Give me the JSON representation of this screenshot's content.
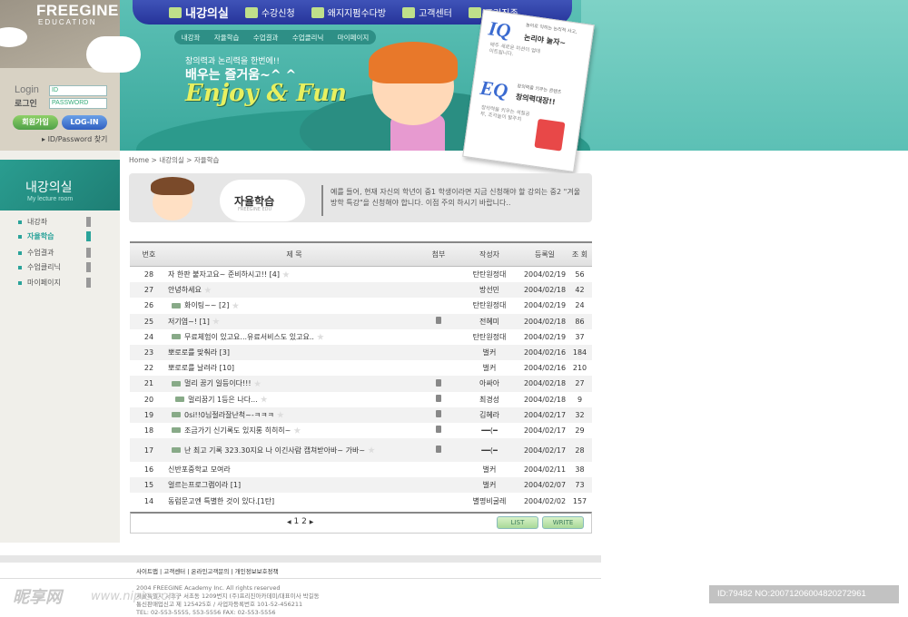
{
  "logo": {
    "name": "FREEGINE",
    "sub": "EDUCATION"
  },
  "login": {
    "label_en": "Login",
    "label_ko": "로그인",
    "id_placeholder": "ID",
    "pw_placeholder": "PASSWORD",
    "join_label": "회원가입",
    "login_label": "LOG-IN",
    "find_label": "ID/Password 찾기"
  },
  "nav": {
    "items": [
      "내강의실",
      "수강신청",
      "왜지지펌수다방",
      "고객센터",
      "프리진존"
    ]
  },
  "subnav": {
    "items": [
      "내강좌",
      "자율학습",
      "수업결과",
      "수업클리닉",
      "마이페이지"
    ]
  },
  "hero": {
    "line1": "창의력과 논리력을 한번에!!",
    "line2": "배우는 즐거움~^ ^",
    "enjoy": "Enjoy & Fun"
  },
  "card": {
    "iq_title": "논리야 놀자~",
    "iq_top": "놀이로 익히는 논리적 사고,",
    "iq_sub": "매주 새로운 미션이 업데이트됩니다.",
    "eq_top": "창의력을 키우는 콘텐츠",
    "eq_title": "창의력대장!!",
    "eq_sub": "창의력을 키우는 색칠공부, 조각놀이 발주치"
  },
  "sidebar": {
    "title": "내강의실",
    "subtitle": "My lecture room",
    "items": [
      "내강좌",
      "자율학습",
      "수업결과",
      "수업클리닉",
      "마이페이지"
    ],
    "active_index": 1
  },
  "breadcrumb": "Home > 내강의실 > 자율학습",
  "banner": {
    "title": "자율학습",
    "sub": "FREEGINE EDU",
    "desc": "예를 들어, 현재 자신의 학년이 중1 학생이라면 지금 신청해야 할 강의는 중2 \"겨울방학 특강\"을 신청해야 합니다. 이점 주의 하시기 바랍니다.."
  },
  "table": {
    "headers": [
      "번호",
      "제 목",
      "첨부",
      "작성자",
      "등록일",
      "조 회"
    ],
    "rows": [
      {
        "no": "28",
        "title": "자 한판 붙자고요~ 준비하시고!! [4]",
        "reply": 0,
        "star": true,
        "att": false,
        "author": "탄탄원정대",
        "date": "2004/02/19",
        "hits": "56"
      },
      {
        "no": "27",
        "title": "안녕하세요",
        "reply": 0,
        "star": true,
        "att": false,
        "author": "방선민",
        "date": "2004/02/18",
        "hits": "42"
      },
      {
        "no": "26",
        "title": "화이팅~~ [2]",
        "reply": 1,
        "star": true,
        "att": false,
        "author": "탄탄원정대",
        "date": "2004/02/19",
        "hits": "24"
      },
      {
        "no": "25",
        "title": "저기염~! [1]",
        "reply": 0,
        "star": true,
        "att": true,
        "author": "전혜미",
        "date": "2004/02/18",
        "hits": "86"
      },
      {
        "no": "24",
        "title": "무료체험이 있고요...유료서비스도 있고요..",
        "reply": 1,
        "star": true,
        "att": false,
        "author": "탄탄원정대",
        "date": "2004/02/19",
        "hits": "37"
      },
      {
        "no": "23",
        "title": "뽀로로를 맞춰라 [3]",
        "reply": 0,
        "star": false,
        "att": false,
        "author": "벌커",
        "date": "2004/02/16",
        "hits": "184"
      },
      {
        "no": "22",
        "title": "뽀로로를 날려라 [10]",
        "reply": 0,
        "star": false,
        "att": false,
        "author": "벌커",
        "date": "2004/02/16",
        "hits": "210"
      },
      {
        "no": "21",
        "title": "멀리 꿈기 일등이다!!!",
        "reply": 1,
        "star": true,
        "att": true,
        "author": "아싸아",
        "date": "2004/02/18",
        "hits": "27"
      },
      {
        "no": "20",
        "title": "멀리꿈기 1등은 나다...",
        "reply": 2,
        "star": true,
        "att": true,
        "author": "최경성",
        "date": "2004/02/18",
        "hits": "9"
      },
      {
        "no": "19",
        "title": "0si!!0님절라잘난척~-ㅋㅋㅋ",
        "reply": 1,
        "star": true,
        "att": true,
        "author": "김혜라",
        "date": "2004/02/17",
        "hits": "32"
      },
      {
        "no": "18",
        "title": "조금가기 신기록도 있지롱 히히히~",
        "reply": 1,
        "star": true,
        "att": true,
        "author": "━━(━",
        "date": "2004/02/17",
        "hits": "29"
      },
      {
        "no": "17",
        "title": "난 최고 기록 323.30지요 나 이긴사람 캡쳐받아바~ 가바~",
        "reply": 1,
        "star": true,
        "att": true,
        "author": "━━(━",
        "date": "2004/02/17",
        "hits": "28"
      },
      {
        "no": "16",
        "title": "신반포중학교 모여라",
        "reply": 0,
        "star": false,
        "att": false,
        "author": "벌커",
        "date": "2004/02/11",
        "hits": "38"
      },
      {
        "no": "15",
        "title": "얼르는프로그램이라 [1]",
        "reply": 0,
        "star": false,
        "att": false,
        "author": "벌커",
        "date": "2004/02/07",
        "hits": "73"
      },
      {
        "no": "14",
        "title": "동럼문고엔 특별한 것이 있다.[1탄]",
        "reply": 0,
        "star": false,
        "att": false,
        "author": "별명비굴레",
        "date": "2004/02/02",
        "hits": "157"
      }
    ]
  },
  "pager": {
    "prev": "◀",
    "pages": "1 2",
    "next": "▶",
    "list_label": "LIST",
    "write_label": "WRITE"
  },
  "footer": {
    "links": "사이트맵  |  고객센터  |  온라인고객문의  |  개인정보보호정책",
    "copy1": "2004 FREEGINE Academy Inc. All rights reserved",
    "copy2": "서울특별시 서초구 서초동 1209번지 (주)프리진아카데미/대표이사 박길동",
    "copy3": "통신판매업신고 제 125425호 / 사업자등록번호 101-52-456211",
    "copy4": "TEL: 02-553-5555, 553-5556 FAX: 02-553-5556"
  },
  "watermark": {
    "site": "昵享网",
    "url": "www.nipic.com",
    "id": "ID:79482 NO:20071206004820272961"
  }
}
